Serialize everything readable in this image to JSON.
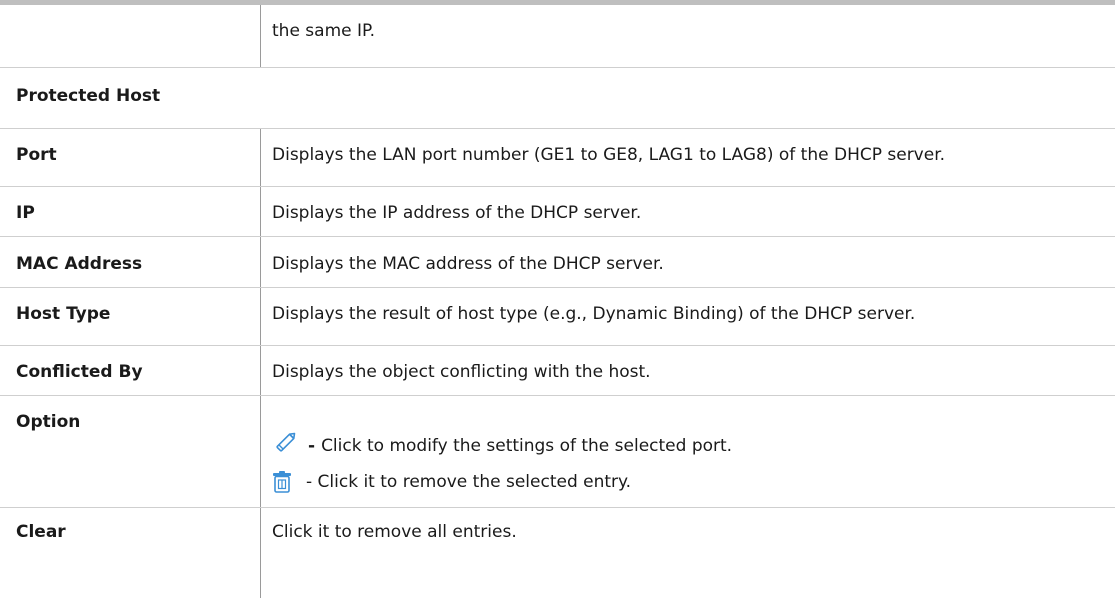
{
  "top_row": {
    "text": "the same IP."
  },
  "section": {
    "title": "Protected Host"
  },
  "rows": [
    {
      "term": "Port",
      "desc": "Displays the LAN port number (GE1 to GE8, LAG1 to LAG8) of the DHCP server."
    },
    {
      "term": "IP",
      "desc": "Displays the IP address of the DHCP server."
    },
    {
      "term": "MAC Address",
      "desc": "Displays the MAC address of the DHCP server."
    },
    {
      "term": "Host Type",
      "desc": "Displays the result of host type (e.g., Dynamic Binding) of the DHCP server."
    },
    {
      "term": "Conflicted By",
      "desc": "Displays the object conflicting with the host."
    },
    {
      "term": "Option",
      "edit_dash": "-",
      "edit_desc": "Click to modify the settings of the selected port.",
      "delete_desc": "- Click it to remove the selected entry.",
      "icons": {
        "edit": "pencil-icon",
        "delete": "trash-icon",
        "accent": "#3b8fd6"
      }
    },
    {
      "term": "Clear",
      "desc": "Click it to remove all entries."
    }
  ]
}
